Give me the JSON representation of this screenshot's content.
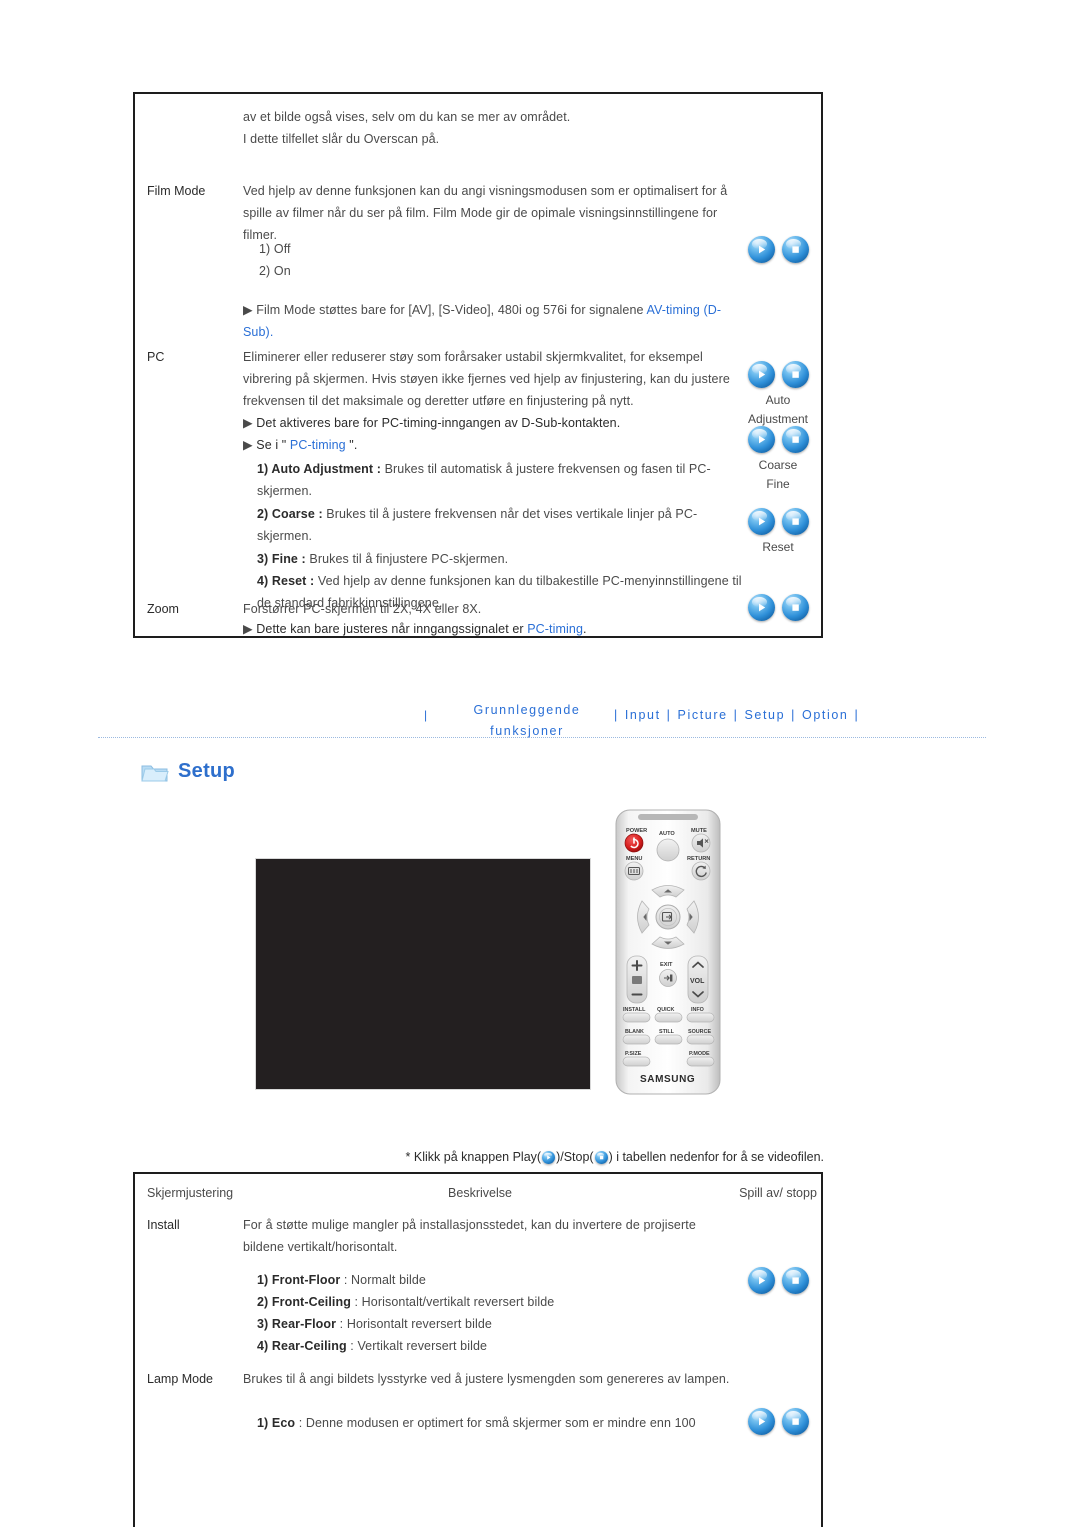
{
  "top_table": {
    "intro": {
      "line1": "av et bilde også vises, selv om du kan se mer av området.",
      "line2": "I dette tilfellet slår du Overscan på."
    },
    "rows": [
      {
        "label": "Film Mode",
        "paragraph": "Ved hjelp av denne funksjonen kan du angi visningsmodusen som er optimalisert for å spille av filmer når du ser på film. Film Mode gir de opimale visningsinnstillingene for filmer.",
        "options": [
          "1) Off",
          "2) On"
        ],
        "note_prefix": "Film Mode støttes bare for [AV], [S-Video], 480i og 576i for signalene ",
        "note_link": "AV-timing (D-Sub)",
        "note_suffix": ".",
        "icon_caption": ""
      },
      {
        "label": "PC",
        "paragraph": "Eliminerer eller reduserer støy som forårsaker ustabil skjermkvalitet, for eksempel vibrering på skjermen. Hvis støyen ikke fjernes ved hjelp av finjustering, kan du justere frekvensen til det maksimale og deretter utføre en finjustering på nytt.",
        "note1": "Det aktiveres bare for PC-timing-inngangen av D-Sub-kontakten.",
        "note2_prefix": "Se i \" ",
        "note2_link": "PC-timing",
        "note2_suffix": " \".",
        "items": [
          {
            "num": "1) Auto Adjustment",
            "sep": " : ",
            "text": "Brukes til automatisk å justere frekvensen og fasen til PC-skjermen."
          },
          {
            "num": "2) Coarse",
            "sep": " : ",
            "text": "Brukes til å justere frekvensen når det vises vertikale linjer på PC-skjermen."
          },
          {
            "num": "3) Fine",
            "sep": " : ",
            "text": "Brukes til å finjustere PC-skjermen."
          },
          {
            "num": "4) Reset",
            "sep": " : ",
            "text": "Ved hjelp av denne funksjonen kan du tilbakestille PC-menyinnstillingene til de standard fabrikkinnstillingene."
          }
        ],
        "icon_captions": [
          "Auto Adjustment",
          "Coarse Fine",
          "Reset"
        ]
      },
      {
        "label": "Zoom",
        "paragraph": "Forstørrer PC-skjermen til 2X, 4X eller 8X.",
        "note_prefix": "Dette kan bare justeres når inngangssignalet er ",
        "note_link": "PC-timing",
        "note_suffix": "."
      }
    ],
    "icon_captions": {
      "auto": "Auto",
      "adjustment": "Adjustment",
      "coarse": "Coarse",
      "fine": "Fine",
      "reset": "Reset"
    }
  },
  "nav": {
    "pipe": "|",
    "section_line1": "Grunnleggende",
    "section_line2": "funksjoner",
    "links": [
      "Input",
      "Picture",
      "Setup",
      "Option"
    ],
    "separator": "|"
  },
  "setup_heading": {
    "icon": "folder-icon",
    "title": "Setup"
  },
  "remote": {
    "brand": "SAMSUNG",
    "labels": {
      "power": "POWER",
      "auto": "AUTO",
      "mute": "MUTE",
      "menu": "MENU",
      "return": "RETURN",
      "exit": "EXIT",
      "vol": "VOL",
      "install": "INSTALL",
      "quick": "QUICK",
      "info": "INFO",
      "blank": "BLANK",
      "still": "STILL",
      "source": "SOURCE",
      "psize": "P.SIZE",
      "pmode": "P.MODE"
    }
  },
  "note_line": {
    "star": "*",
    "part1": "Klikk på knappen Play(",
    "part2": ")/Stop(",
    "part3": ") i tabellen nedenfor for å se videofilen."
  },
  "bottom_table": {
    "headers": [
      "Skjermjustering",
      "Beskrivelse",
      "Spill av/ stopp"
    ],
    "rows": [
      {
        "label": "Install",
        "paragraph": "For å støtte mulige mangler på installasjonsstedet, kan du invertere de projiserte bildene vertikalt/horisontalt.",
        "items": [
          {
            "num": "1) Front-Floor",
            "sep": " : ",
            "text": "Normalt bilde"
          },
          {
            "num": "2) Front-Ceiling",
            "sep": " : ",
            "text": "Horisontalt/vertikalt reversert bilde"
          },
          {
            "num": "3) Rear-Floor",
            "sep": " : ",
            "text": "Horisontalt reversert bilde"
          },
          {
            "num": "4) Rear-Ceiling",
            "sep": " : ",
            "text": "Vertikalt reversert bilde"
          }
        ]
      },
      {
        "label": "Lamp Mode",
        "paragraph": "Brukes til å angi bildets lysstyrke ved å justere lysmengden som genereres av lampen.",
        "items": [
          {
            "num": "1) Eco",
            "sep": " : ",
            "text": "Denne modusen er optimert for små skjermer som er mindre enn 100"
          }
        ]
      }
    ]
  },
  "colors": {
    "link": "#2a6fd6",
    "text": "#4a4a4a",
    "border": "#1d1d1d",
    "video": "#231f20"
  }
}
